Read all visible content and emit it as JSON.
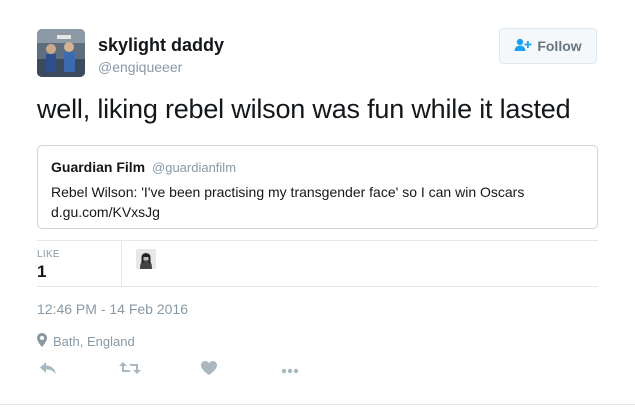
{
  "author": {
    "display_name": "skylight daddy",
    "screen_name": "@engiqueeer"
  },
  "follow_button": {
    "label": "Follow",
    "icon": "add-user-icon"
  },
  "tweet": {
    "text": "well, liking rebel wilson was fun while it lasted"
  },
  "quoted_tweet": {
    "display_name": "Guardian Film",
    "screen_name": "@guardianfilm",
    "text_line1": "Rebel Wilson: 'I've been practising my transgender face' so I can win Oscars",
    "text_line2": "d.gu.com/KVxsJg"
  },
  "stats": {
    "likes_label": "LIKE",
    "likes_count": "1"
  },
  "meta": {
    "timestamp": "12:46 PM - 14 Feb 2016",
    "location": "Bath, England"
  },
  "actions": [
    {
      "name": "reply",
      "icon": "reply-icon"
    },
    {
      "name": "retweet",
      "icon": "retweet-icon"
    },
    {
      "name": "like",
      "icon": "heart-icon"
    },
    {
      "name": "more",
      "icon": "more-icon"
    }
  ],
  "colors": {
    "text": "#14171a",
    "secondary": "#8899a6",
    "border": "#e1e8ed",
    "action_icon": "#aab8c2"
  }
}
